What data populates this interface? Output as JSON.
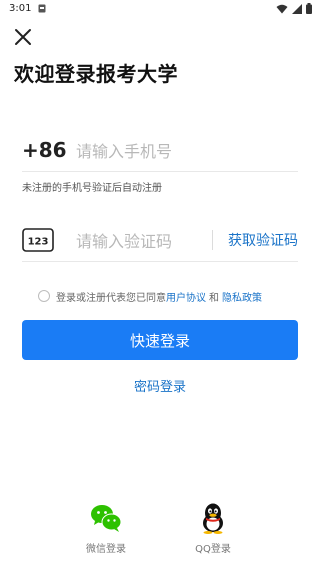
{
  "status_bar": {
    "time": "3:01",
    "icons": [
      "notification-icon",
      "wifi-icon",
      "signal-icon",
      "battery-icon"
    ]
  },
  "close": {
    "icon": "close-icon"
  },
  "title": "欢迎登录报考大学",
  "phone": {
    "country_code": "+86",
    "placeholder": "请输入手机号",
    "value": "",
    "hint": "未注册的手机号验证后自动注册"
  },
  "code": {
    "icon": "123-keypad-icon",
    "icon_text": "123",
    "placeholder": "请输入验证码",
    "value": "",
    "get_code_label": "获取验证码"
  },
  "agreement": {
    "checked": false,
    "text": "登录或注册代表您已同意",
    "user_agreement": "用户协议",
    "and": "和",
    "privacy_policy": "隐私政策"
  },
  "login_button": "快速登录",
  "password_login": "密码登录",
  "social": {
    "wechat_label": "微信登录",
    "qq_label": "QQ登录"
  },
  "colors": {
    "accent": "#1a7cf5",
    "link": "#1a73c8",
    "wechat": "#2dc100"
  }
}
